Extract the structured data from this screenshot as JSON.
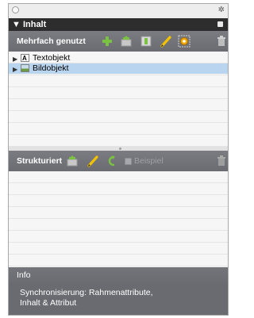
{
  "panel": {
    "title": "▼ Inhalt"
  },
  "mehrfach": {
    "label": "Mehrfach genutzt",
    "items": [
      {
        "label": "Textobjekt",
        "icon": "text-frame-icon",
        "selected": false
      },
      {
        "label": "Bildobjekt",
        "icon": "image-frame-icon",
        "selected": true
      }
    ]
  },
  "strukturiert": {
    "label": "Strukturiert",
    "checkbox_label": "Beispiel"
  },
  "info": {
    "label": "Info",
    "line1": "Synchronisierung: Rahmenattribute,",
    "line2": "Inhalt & Attribut"
  },
  "icons": {
    "add": "plus-icon",
    "place": "place-content-icon",
    "frame": "frame-icon",
    "edit": "pencil-icon",
    "sync": "sync-icon",
    "trash": "trash-icon",
    "undo": "undo-icon",
    "gear": "gear-icon"
  },
  "colors": {
    "title_bar": "#2d2d2d",
    "section_header": "#6b6c72",
    "selection": "#b9d4ee",
    "accent_green": "#7cc242",
    "accent_yellow": "#f2c200"
  }
}
